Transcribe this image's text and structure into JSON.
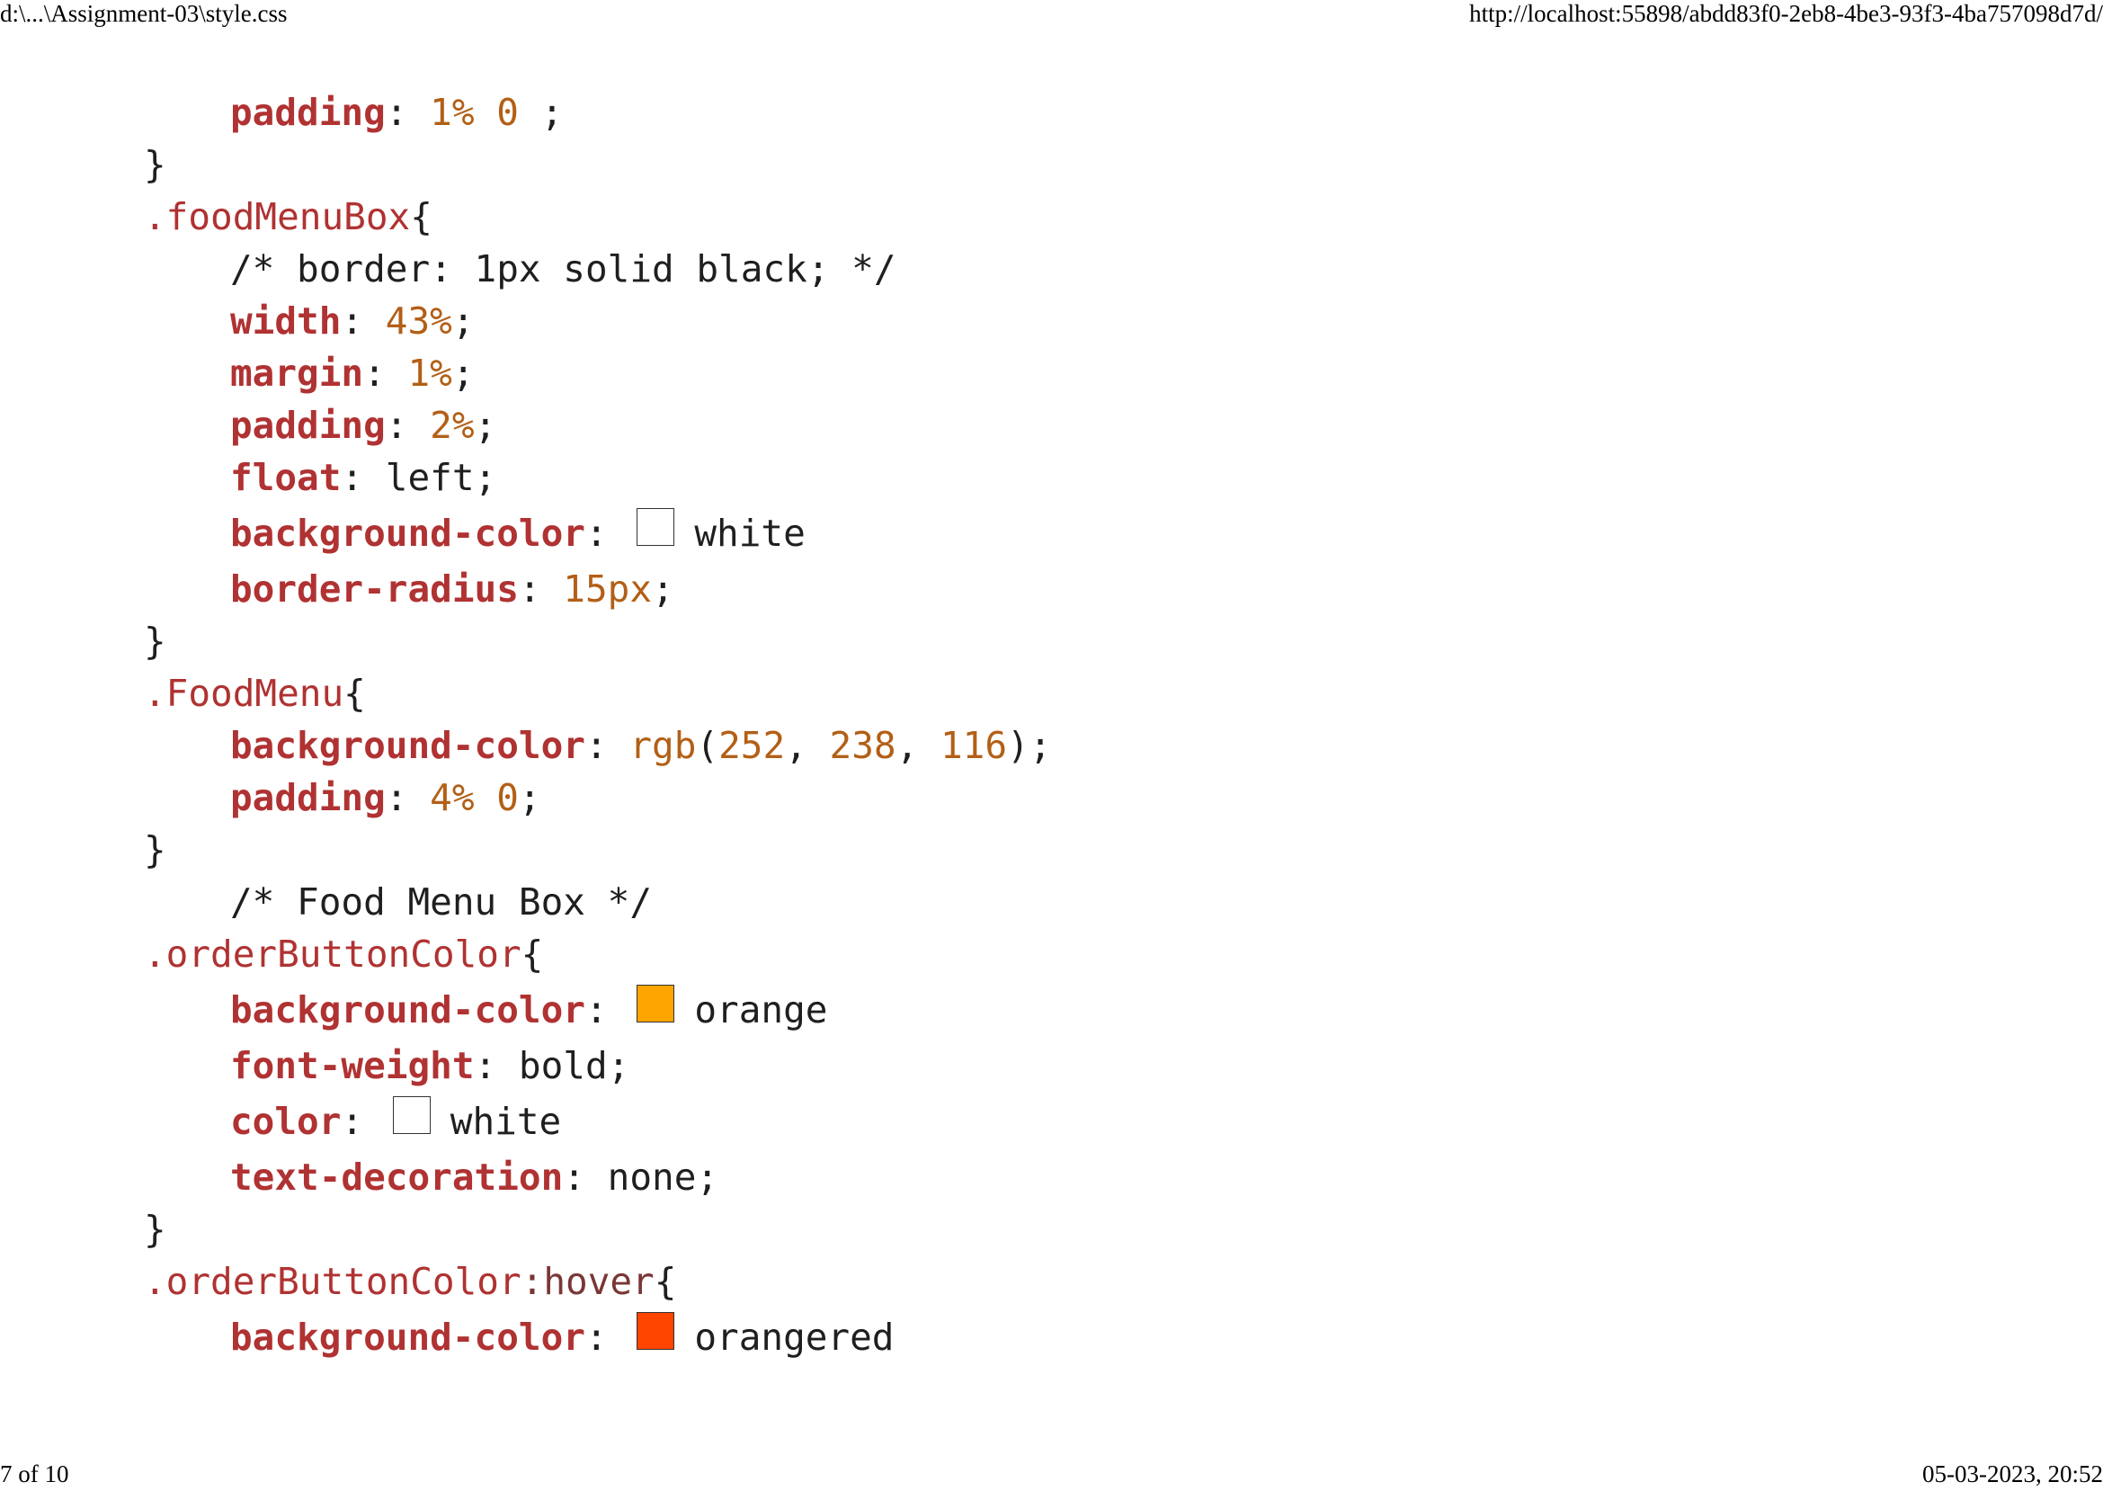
{
  "header": {
    "file_path": "d:\\...\\Assignment-03\\style.css",
    "url": "http://localhost:55898/abdd83f0-2eb8-4be3-93f3-4ba757098d7d/"
  },
  "footer": {
    "page_indicator": "7 of 10",
    "datetime": "05-03-2023, 20:52"
  },
  "code": {
    "l1": {
      "prop": "padding",
      "sep": ": ",
      "v1": "1% 0",
      "end": " ;"
    },
    "l2": {
      "brace": "}"
    },
    "l3": {
      "selector": ".foodMenuBox",
      "brace": "{"
    },
    "l4": {
      "comment": "/* border: 1px solid black; */"
    },
    "l5": {
      "prop": "width",
      "sep": ": ",
      "v1": "43%",
      "end": ";"
    },
    "l6": {
      "prop": "margin",
      "sep": ": ",
      "v1": "1%",
      "end": ";"
    },
    "l7": {
      "prop": "padding",
      "sep": ": ",
      "v1": "2%",
      "end": ";"
    },
    "l8": {
      "prop": "float",
      "sep": ": ",
      "val": "left;"
    },
    "l9": {
      "prop": "background-color",
      "sep": ": ",
      "color_name": "white",
      "swatch": "#ffffff"
    },
    "l10": {
      "prop": "border-radius",
      "sep": ": ",
      "v1": "15px",
      "end": ";"
    },
    "l11": {
      "brace": "}"
    },
    "l12": {
      "selector": ".FoodMenu",
      "brace": "{"
    },
    "l13": {
      "prop": "background-color",
      "sep": ": ",
      "fn": "rgb",
      "open": "(",
      "a": "252",
      "c1": ", ",
      "b": "238",
      "c2": ", ",
      "c": "116",
      "end": ");"
    },
    "l14": {
      "prop": "padding",
      "sep": ": ",
      "v1": "4% 0",
      "end": ";"
    },
    "l15": {
      "brace": "}"
    },
    "l16": {
      "comment": "/* Food Menu Box */"
    },
    "l17": {
      "selector": ".orderButtonColor",
      "brace": "{"
    },
    "l18": {
      "prop": "background-color",
      "sep": ": ",
      "color_name": "orange",
      "swatch": "#ffa500"
    },
    "l19": {
      "prop": "font-weight",
      "sep": ": ",
      "val": "bold;"
    },
    "l20": {
      "prop": "color",
      "sep": ": ",
      "color_name": "white",
      "swatch": "#ffffff"
    },
    "l21": {
      "prop": "text-decoration",
      "sep": ": ",
      "val": "none;"
    },
    "l22": {
      "brace": "}"
    },
    "l23": {
      "selector": ".orderButtonColor",
      "pseudo": ":hover",
      "brace": "{"
    },
    "l24": {
      "prop": "background-color",
      "sep": ": ",
      "color_name": "orangered",
      "swatch": "#ff4500"
    }
  }
}
